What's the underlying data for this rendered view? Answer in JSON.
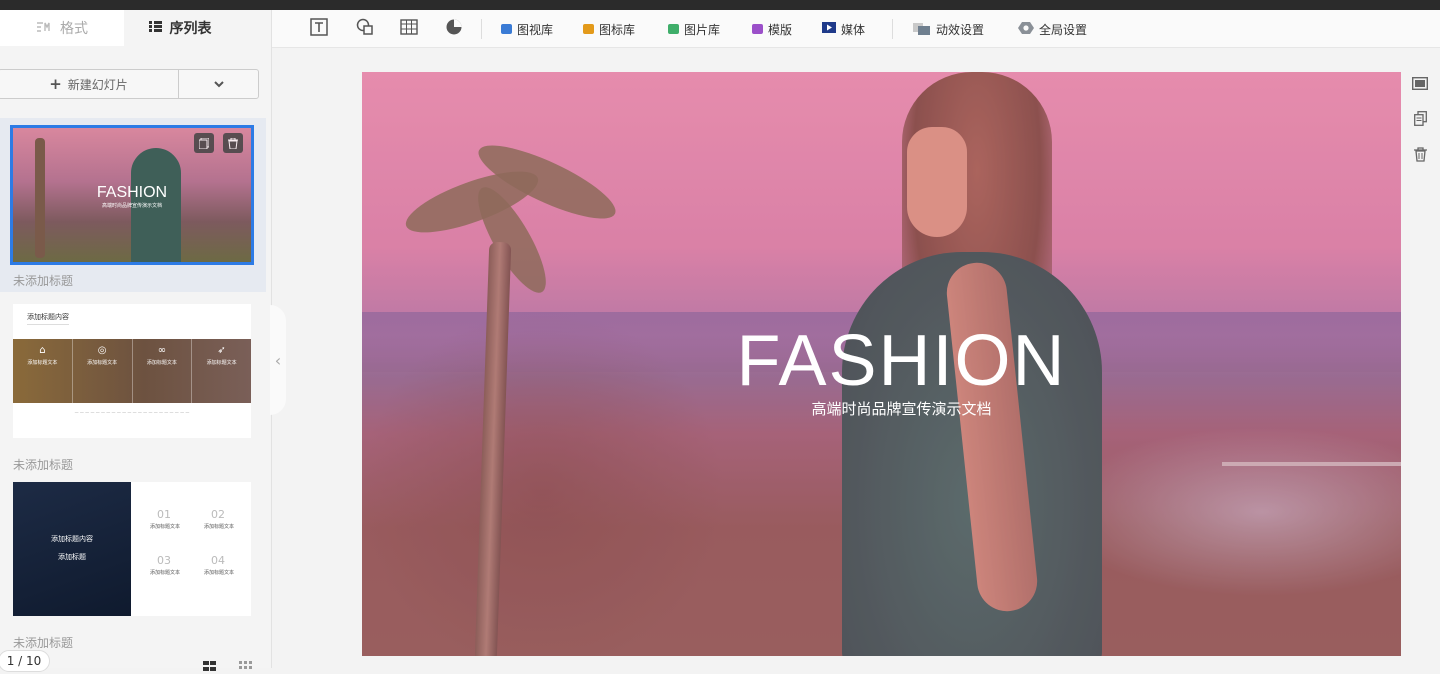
{
  "tabs": {
    "format": "格式",
    "sequence": "序列表"
  },
  "new_slide": {
    "label": "新建幻灯片"
  },
  "slides": [
    {
      "caption": "未添加标题",
      "title": "FASHION",
      "subtitle": "高端时尚品牌宣传演示文档"
    },
    {
      "caption": "未添加标题",
      "heading": "添加标题内容",
      "cols": [
        "添加标题文本",
        "添加标题文本",
        "添加标题文本",
        "添加标题文本"
      ]
    },
    {
      "caption": "未添加标题",
      "line1": "添加标题内容",
      "line2": "添加标题",
      "nums": [
        "01",
        "02",
        "03",
        "04"
      ],
      "label": "添加标题文本"
    }
  ],
  "pager": "1 / 10",
  "toolbar": {
    "chart_lib": "图视库",
    "icon_lib": "图标库",
    "image_lib": "图片库",
    "template": "模版",
    "media": "媒体",
    "animation": "动效设置",
    "global": "全局设置"
  },
  "canvas": {
    "title": "FASHION",
    "subtitle": "高端时尚品牌宣传演示文档"
  },
  "colors": {
    "accent": "#2d7be5"
  }
}
